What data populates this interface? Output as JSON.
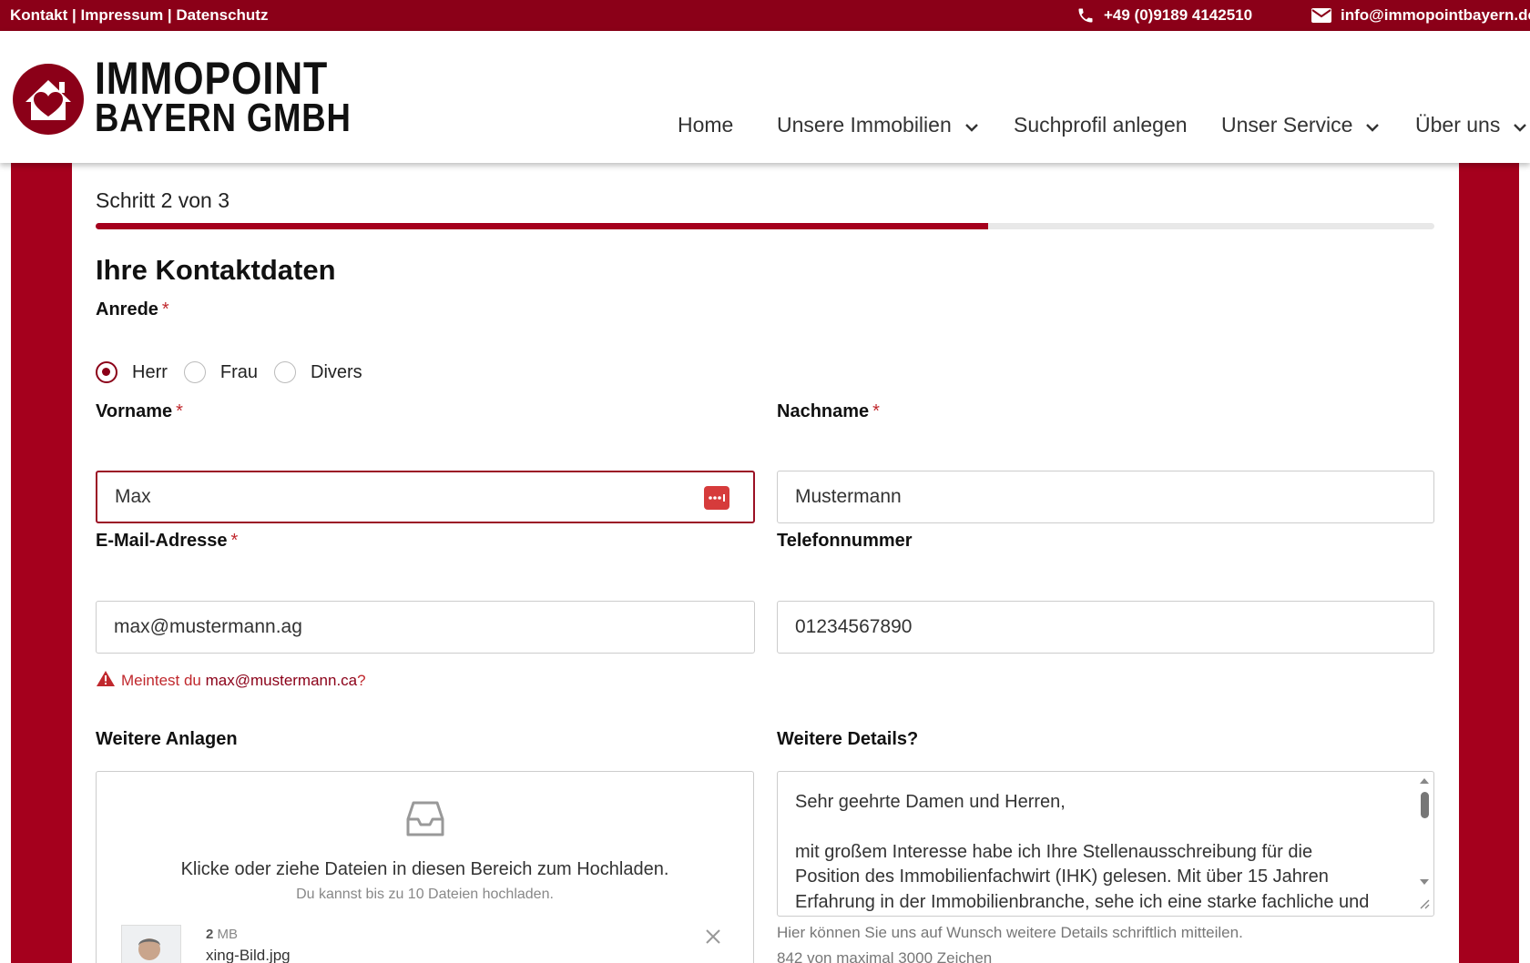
{
  "topbar": {
    "links": [
      "Kontakt",
      "Impressum",
      "Datenschutz"
    ],
    "separator": " | ",
    "phone": "+49 (0)9189 4142510",
    "email": "info@immopointbayern.de"
  },
  "logo": {
    "line1": "IMMOPOINT",
    "line2": "BAYERN GMBH"
  },
  "nav": {
    "home": "Home",
    "immobilien": "Unsere Immobilien",
    "suchprofil": "Suchprofil anlegen",
    "service": "Unser Service",
    "ueber": "Über uns"
  },
  "form": {
    "step": "Schritt 2 von 3",
    "progress_fraction": 0.667,
    "title": "Ihre Kontaktdaten",
    "required_mark": "*",
    "anrede": {
      "label": "Anrede",
      "options": [
        "Herr",
        "Frau",
        "Divers"
      ],
      "selected": "Herr"
    },
    "vorname": {
      "label": "Vorname",
      "value": "Max"
    },
    "nachname": {
      "label": "Nachname",
      "value": "Mustermann"
    },
    "email": {
      "label": "E-Mail-Adresse",
      "value": "max@mustermann.ag"
    },
    "telefon": {
      "label": "Telefonnummer",
      "value": "01234567890"
    },
    "email_hint": {
      "prefix": "Meintest du ",
      "suggestion": "max@mustermann.ca",
      "suffix": "?"
    },
    "anlagen": {
      "label": "Weitere Anlagen",
      "drop_text": "Klicke oder ziehe Dateien in diesen Bereich zum Hochladen.",
      "drop_subtext": "Du kannst bis zu 10 Dateien hochladen.",
      "file": {
        "size_num": "2",
        "size_unit": " MB",
        "name": "xing-Bild.jpg"
      }
    },
    "details": {
      "label": "Weitere Details?",
      "text_line1": "Sehr geehrte Damen und Herren,",
      "text_line2": "mit großem Interesse habe ich Ihre Stellenausschreibung für die Position des Immobilienfachwirt (IHK) gelesen. Mit über 15 Jahren Erfahrung in der Immobilienbranche, sehe ich eine starke fachliche und unternehmerische Passung",
      "help": "Hier können Sie uns auf Wunsch weitere Details schriftlich mitteilen.",
      "count": "842 von maximal 3000 Zeichen"
    }
  },
  "colors": {
    "brand": "#8b0018",
    "band": "#a5001d",
    "required": "#c0282d"
  }
}
